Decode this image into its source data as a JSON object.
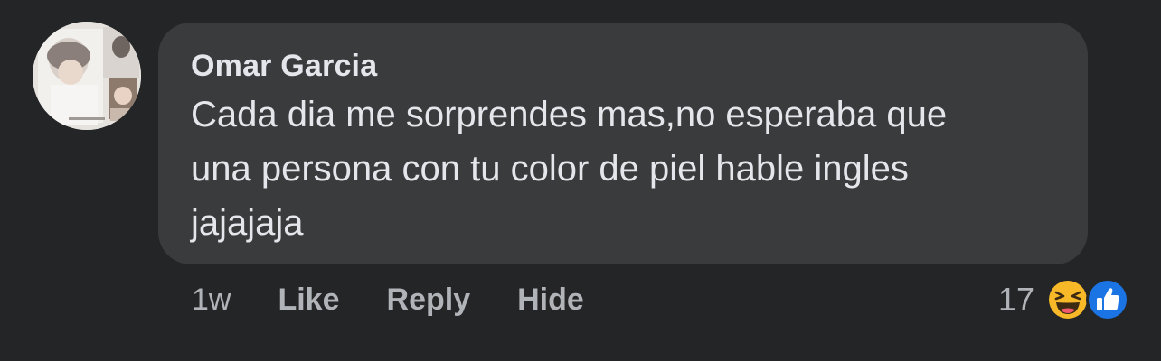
{
  "comment": {
    "author": "Omar Garcia",
    "text": "Cada dia me sorprendes mas,no esperaba que\nuna persona con tu color de piel hable ingles\njajajaja",
    "timestamp": "1w",
    "actions": {
      "like_label": "Like",
      "reply_label": "Reply",
      "hide_label": "Hide"
    },
    "reactions": {
      "count": "17",
      "icons": [
        "laughing-emoji-icon",
        "thumbs-up-icon"
      ]
    }
  },
  "colors": {
    "background": "#242526",
    "bubble": "#3a3b3c",
    "primary_text": "#e4e6eb",
    "secondary_text": "#b0b3b8",
    "like_blue": "#1b74e4",
    "haha_yellow": "#f7b928"
  }
}
